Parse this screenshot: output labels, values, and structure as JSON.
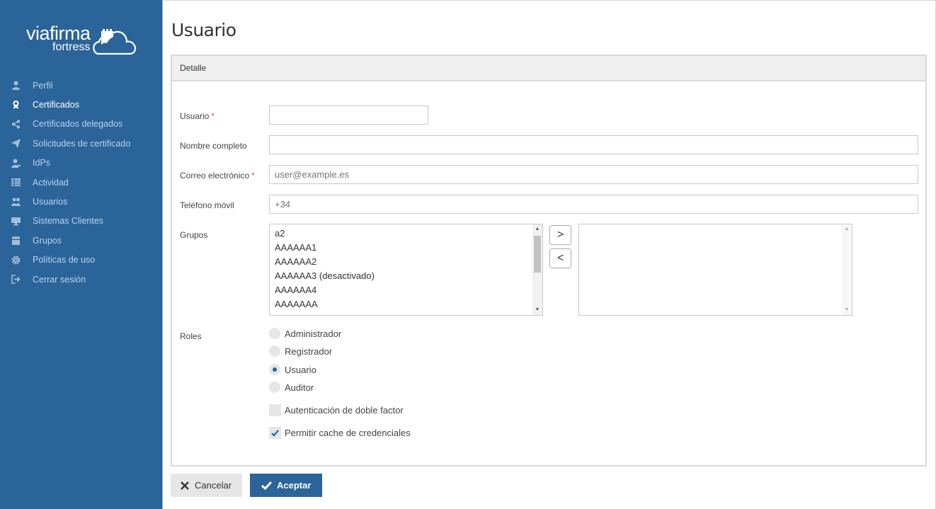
{
  "brand": {
    "name": "viafirma",
    "product": "fortress"
  },
  "sidebar": {
    "items": [
      {
        "label": "Perfil",
        "icon": "user-icon",
        "active": false
      },
      {
        "label": "Certificados",
        "icon": "certificate-icon",
        "active": true
      },
      {
        "label": "Certificados delegados",
        "icon": "share-icon",
        "active": false
      },
      {
        "label": "Solicitudes de certificado",
        "icon": "paper-plane-icon",
        "active": false
      },
      {
        "label": "IdPs",
        "icon": "user-key-icon",
        "active": false
      },
      {
        "label": "Actividad",
        "icon": "table-icon",
        "active": false
      },
      {
        "label": "Usuarios",
        "icon": "users-icon",
        "active": false
      },
      {
        "label": "Sistemas Clientes",
        "icon": "monitor-icon",
        "active": false
      },
      {
        "label": "Grupos",
        "icon": "group-icon",
        "active": false
      },
      {
        "label": "Políticas de uso",
        "icon": "gear-icon",
        "active": false
      },
      {
        "label": "Cerrar sesión",
        "icon": "sign-out-icon",
        "active": false
      }
    ]
  },
  "page": {
    "title": "Usuario"
  },
  "panel": {
    "heading": "Detalle"
  },
  "form": {
    "usuario": {
      "label": "Usuario",
      "required_mark": "*",
      "value": ""
    },
    "nombre": {
      "label": "Nombre completo",
      "value": ""
    },
    "correo": {
      "label": "Correo electrónico",
      "required_mark": "*",
      "placeholder": "user@example.es"
    },
    "telefono": {
      "label": "Teléfono móvil",
      "placeholder": "+34"
    },
    "grupos": {
      "label": "Grupos",
      "available": [
        "a2",
        "AAAAAA1",
        "AAAAAA2",
        "AAAAAA3 (desactivado)",
        "AAAAAA4",
        "AAAAAAA"
      ],
      "selected": [],
      "add_symbol": ">",
      "remove_symbol": "<"
    },
    "roles": {
      "label": "Roles",
      "options": [
        {
          "label": "Administrador",
          "checked": false
        },
        {
          "label": "Registrador",
          "checked": false
        },
        {
          "label": "Usuario",
          "checked": true
        },
        {
          "label": "Auditor",
          "checked": false
        }
      ]
    },
    "doble_factor": {
      "label": "Autenticación de doble factor",
      "checked": false
    },
    "cache": {
      "label": "Permitir cache de credenciales",
      "checked": true
    }
  },
  "actions": {
    "cancel": "Cancelar",
    "accept": "Aceptar"
  },
  "colors": {
    "sidebar_bg": "#2b6499",
    "accent": "#2b6499",
    "required": "#d9534f"
  }
}
